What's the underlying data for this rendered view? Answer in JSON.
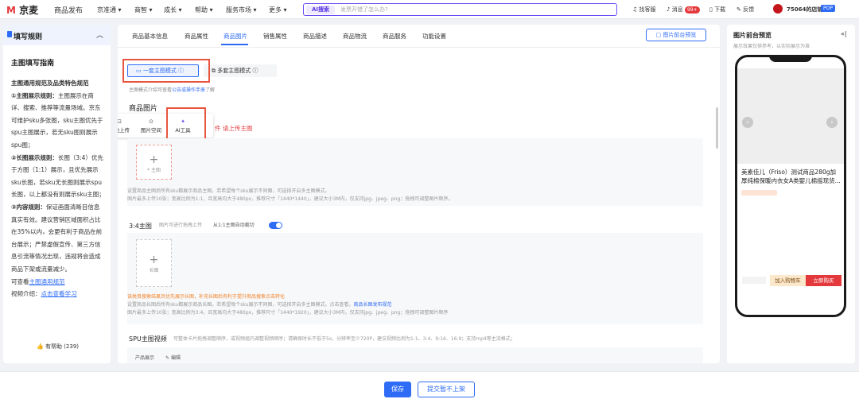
{
  "topbar": {
    "logo_mark": "M",
    "logo_text": "京麦",
    "nav_primary": "商品发布",
    "nav": [
      "京准通 ▾",
      "商智 ▾",
      "成长 ▾",
      "帮助 ▾",
      "服务市场 ▾",
      "更多 ▾"
    ],
    "ai_tag": "AI搜索",
    "ai_placeholder": "发票开错了怎么办?",
    "find_customer_service": "找客服",
    "messages": "消息",
    "message_count": "99+",
    "download": "下载",
    "feedback": "反馈",
    "shop_name": "75064的店铺",
    "shop_badge": "POP"
  },
  "left_panel": {
    "header_title": "填写规则",
    "guide_title": "主图填写指南",
    "section_title": "主图通用规范及品类特色规范",
    "rule1_label": "①主图展示规则：",
    "rule1_text": "主图展示在商详、搜索、推荐等流量场域。京东可维护sku多张图，sku主图优先于spu主图展示，若无sku图则展示spu图；",
    "rule2_label": "②长图展示规则：",
    "rule2_text": "长图（3:4）优先于方图（1:1）展示，且优先展示sku长图，若sku无长图则展示spu长图，以上都没有则展示sku主图；",
    "rule3_label": "③内容规则：",
    "rule3_text": "保证画面清晰目信息真实有效。建议营销区域面积占比在35%以内，会更有利于商品在前台展示；严禁虚假宣传、第三方信息引流等情况出现，违规将会造成商品下架或流量减少。",
    "view_prefix": "可查看",
    "view_link": "主图通用规范",
    "video_prefix": "视频介绍：",
    "video_link": "点击查看学习",
    "helpful": "有帮助 (239)"
  },
  "tabs": [
    "商品基本信息",
    "商品属性",
    "商品图片",
    "销售属性",
    "商品描述",
    "商品物流",
    "商品服务",
    "功能设置"
  ],
  "active_tab": "商品图片",
  "preview_button": "图片前台预览",
  "main_image": {
    "mode_single": "一套主图模式",
    "mode_multi": "多套主图模式",
    "mode_hint_prefix": "主图模式介绍可查看",
    "mode_hint_link": "公告或操作手册",
    "mode_hint_suffix": "了解",
    "section_title": "商品图片",
    "upload_local": "本地上传",
    "upload_space": "图片空间",
    "upload_ai": "AI工具",
    "required_hint": "请上传主图",
    "slot_label": "* 主图",
    "desc_line1": "设置商品主图后所有sku都展示商品主图。若希望每个sku展示不同图，可选择开启多主图模式。",
    "desc_line2": "图片最多上传10张；宽高比例为1:1，且宽高均大于480px，推荐尺寸「1440*1440」，建议大小3M内，仅支持jpg、jpeg、png；拖拽可调整图片顺序。"
  },
  "long_image": {
    "title": "3:4主图",
    "hint": "图片可进行拖拽上传",
    "auto_crop": "从1:1主图自动裁切",
    "slot_label": "长图",
    "warn": "该类目搜索结果页优先展示长图，补充长图后有利于提升商品搜索点击转化",
    "desc_line1": "设置商品长图后所有sku都展示商品长图。若希望每个sku展示不同图，可选择开启多主图模式。点击查看，",
    "desc_link": "商品长图发布规范",
    "desc_line2": "图片最多上传10张；宽高比例为3:4，且宽高均大于480px，推荐尺寸「1440*1920」，建议大小3M内，仅支持jpg、jpeg、png；拖拽可调整图片顺序"
  },
  "video": {
    "title": "SPU主图视频",
    "hint": "可整体卡片拖拽调整顺序，或视频组内调整视频顺序；请确保时长不低于5s，分辨率至少720P，建议视频比例为1:1、3:4、9:16、16:9；支持mp4等主流格式；",
    "sub_label": "产品展示",
    "edit": "编辑"
  },
  "footer": {
    "save": "保存",
    "submit": "提交暂不上架"
  },
  "right_panel": {
    "title": "图片前台预览",
    "subtitle": "展示效果仅供参考，以实际展示为准",
    "collapse_icon": "«|",
    "product_name": "美素佳儿（Friso）测试商品280g加厚纯棉保暖内衣女A类婴儿棉摇现货...",
    "add_to_cart": "加入购物车",
    "buy_now": "立即购买"
  },
  "colors": {
    "accent": "#2f6cf6",
    "highlight_box": "#e8553e",
    "warning": "#e4393c",
    "ai_purple": "#6b4cf6"
  }
}
